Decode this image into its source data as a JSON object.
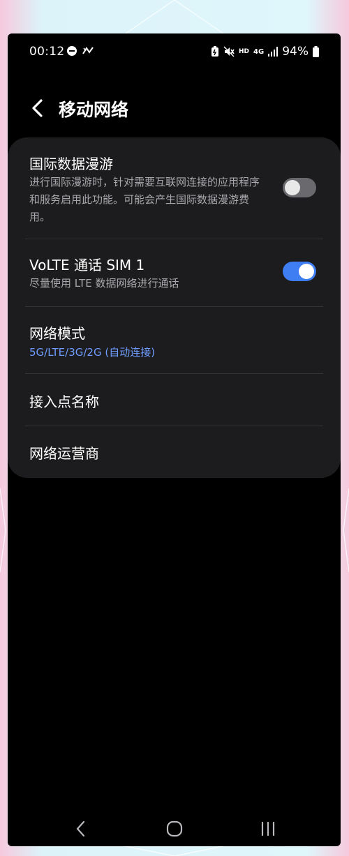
{
  "status_bar": {
    "time": "00:12",
    "battery_percent": "94%",
    "hd_label": "HD",
    "network_label": "4G"
  },
  "header": {
    "title": "移动网络"
  },
  "settings": [
    {
      "title": "国际数据漫游",
      "subtitle": "进行国际漫游时，针对需要互联网连接的应用程序和服务启用此功能。可能会产生国际数据漫游费用。",
      "toggle": "off"
    },
    {
      "title": "VoLTE 通话 SIM 1",
      "subtitle": "尽量使用 LTE 数据网络进行通话",
      "toggle": "on"
    },
    {
      "title": "网络模式",
      "subtitle": "5G/LTE/3G/2G (自动连接)"
    },
    {
      "title": "接入点名称"
    },
    {
      "title": "网络运营商"
    }
  ],
  "colors": {
    "accent": "#3f7df3",
    "link_text": "#6e9dff",
    "card_bg": "#1c1c1e"
  },
  "icons": {
    "status": [
      "dnd-icon",
      "nfc-icon",
      "battery-saver-icon",
      "mute-icon",
      "signal-icon",
      "battery-icon"
    ],
    "nav": [
      "back-nav-icon",
      "home-nav-icon",
      "recents-nav-icon"
    ]
  }
}
